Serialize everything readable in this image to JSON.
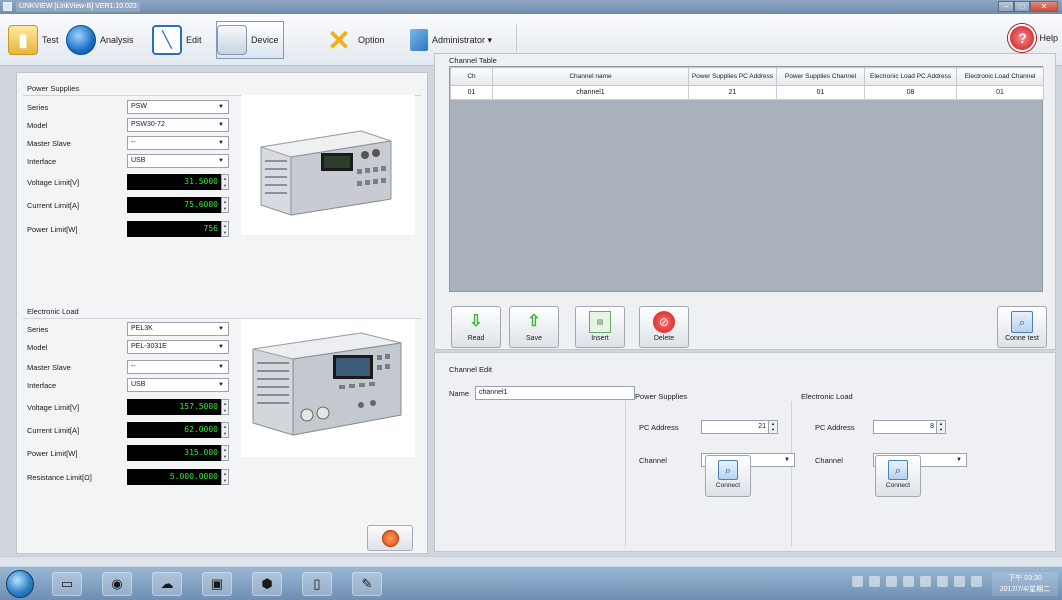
{
  "window": {
    "title": "LINKVIEW [LinkView-B] VER1.10.023"
  },
  "toolbar": {
    "test_label": "Test",
    "analysis_label": "Analysis",
    "edit_label": "Edit",
    "device_label": "Device",
    "option_label": "Option",
    "administrator_label": "Administrator ▾",
    "help_label": "Help"
  },
  "power_supplies": {
    "group_title": "Power Supplies",
    "series_label": "Series",
    "series_value": "PSW",
    "model_label": "Model",
    "model_value": "PSW30-72",
    "master_slave_label": "Master Slave",
    "master_slave_value": "--",
    "interface_label": "Interface",
    "interface_value": "USB",
    "voltage_label": "Voltage Limit[V]",
    "voltage_value": "31.5000",
    "current_label": "Current Limit[A]",
    "current_value": "75.6000",
    "power_label": "Power Limit[W]",
    "power_value": "756"
  },
  "electronic_load": {
    "group_title": "Electronic Load",
    "series_label": "Series",
    "series_value": "PEL3K",
    "model_label": "Model",
    "model_value": "PEL-3031E",
    "master_slave_label": "Master Slave",
    "master_slave_value": "--",
    "interface_label": "Interface",
    "interface_value": "USB",
    "voltage_label": "Voltage Limit[V]",
    "voltage_value": "157.5000",
    "current_label": "Current Limit[A]",
    "current_value": "62.0000",
    "power_label": "Power Limit[W]",
    "power_value": "315.000",
    "resistance_label": "Resistance Limit[Ω]",
    "resistance_value": "5.000.0000"
  },
  "channel_table": {
    "title": "Channel Table",
    "headers": [
      "Ch",
      "Channel name",
      "Power Supplies PC Address",
      "Power Supplies Channel",
      "Electronic Load PC Address",
      "Electronic Load Channel"
    ],
    "rows": [
      [
        "01",
        "channel1",
        "21",
        "01",
        "08",
        "01"
      ]
    ]
  },
  "actions": {
    "read_label": "Read",
    "save_label": "Save",
    "insert_label": "Insert",
    "delete_label": "Delete",
    "conn_test_label": "Conne test"
  },
  "channel_edit": {
    "title": "Channel Edit",
    "name_label": "Name",
    "name_value": "channel1",
    "ps_title": "Power Supplies",
    "ps_pc_label": "PC Address",
    "ps_pc_value": "21",
    "ps_channel_label": "Channel",
    "ps_channel_value": "1",
    "ps_connect_label": "Connect",
    "el_title": "Electronic Load",
    "el_pc_label": "PC Address",
    "el_pc_value": "8",
    "el_channel_label": "Channel",
    "el_channel_value": "1",
    "el_connect_label": "Connect"
  },
  "taskbar": {
    "time": "下午 03:30",
    "date": "2017/7/4/星期二"
  }
}
